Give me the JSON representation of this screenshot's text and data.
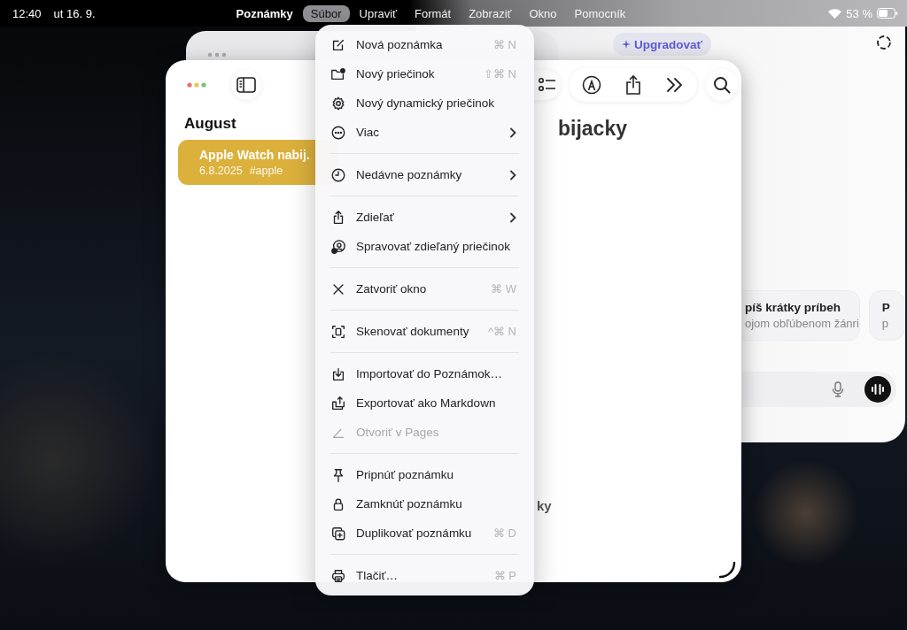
{
  "status_bar": {
    "time": "12:40",
    "date": "ut 16. 9.",
    "battery": "53 %"
  },
  "menu_bar": [
    {
      "label": "Poznámky",
      "kind": "app",
      "selected": false
    },
    {
      "label": "Súbor",
      "kind": "menu",
      "selected": true
    },
    {
      "label": "Upraviť",
      "kind": "menu",
      "selected": false
    },
    {
      "label": "Formát",
      "kind": "menu",
      "selected": false
    },
    {
      "label": "Zobraziť",
      "kind": "menu",
      "selected": false
    },
    {
      "label": "Okno",
      "kind": "menu",
      "selected": false
    },
    {
      "label": "Pomocník",
      "kind": "menu",
      "selected": false
    }
  ],
  "back_window": {
    "upgrade_button": "Upgradovať",
    "suggestions": [
      {
        "title": "píš krátky príbeh",
        "subtitle": "ojom obľúbenom žánri"
      },
      {
        "title": "P",
        "subtitle": "p"
      }
    ]
  },
  "notes_window": {
    "section": "August",
    "notes": [
      {
        "title": "Apple Watch nabij.",
        "date": "6.8.2025",
        "tag": "#apple",
        "selected": true
      }
    ],
    "title": "bijacky",
    "body": "ky"
  },
  "file_menu": {
    "groups": [
      {
        "items": [
          {
            "label": "Nová poznámka",
            "kind": "command",
            "shortcut": "⌘ N",
            "disabled": false
          },
          {
            "label": "Nový priečinok",
            "kind": "command",
            "shortcut": "⇧⌘ N",
            "disabled": false
          },
          {
            "label": "Nový dynamický priečinok",
            "kind": "command",
            "disabled": false
          },
          {
            "label": "Viac",
            "kind": "submenu",
            "disabled": false
          }
        ]
      },
      {
        "items": [
          {
            "label": "Nedávne poznámky",
            "kind": "submenu",
            "disabled": false
          }
        ]
      },
      {
        "items": [
          {
            "label": "Zdieľať",
            "kind": "submenu",
            "disabled": false
          },
          {
            "label": "Spravovať zdieľaný priečinok",
            "kind": "command",
            "disabled": false
          }
        ]
      },
      {
        "items": [
          {
            "label": "Zatvoriť okno",
            "kind": "command",
            "shortcut": "⌘ W",
            "disabled": false
          }
        ]
      },
      {
        "items": [
          {
            "label": "Skenovať dokumenty",
            "kind": "command",
            "shortcut": "^⌘ N",
            "disabled": false
          }
        ]
      },
      {
        "items": [
          {
            "label": "Importovať do Poznámok…",
            "kind": "command",
            "disabled": false
          },
          {
            "label": "Exportovať ako Markdown",
            "kind": "command",
            "disabled": false
          },
          {
            "label": "Otvoriť v Pages",
            "kind": "command",
            "disabled": true
          }
        ]
      },
      {
        "items": [
          {
            "label": "Pripnúť poznámku",
            "kind": "command",
            "disabled": false
          },
          {
            "label": "Zamknúť poznámku",
            "kind": "command",
            "disabled": false
          },
          {
            "label": "Duplikovať poznámku",
            "kind": "command",
            "shortcut": "⌘ D",
            "disabled": false
          }
        ]
      },
      {
        "items": [
          {
            "label": "Tlačiť…",
            "kind": "command",
            "shortcut": "⌘ P",
            "disabled": false
          }
        ]
      }
    ]
  }
}
